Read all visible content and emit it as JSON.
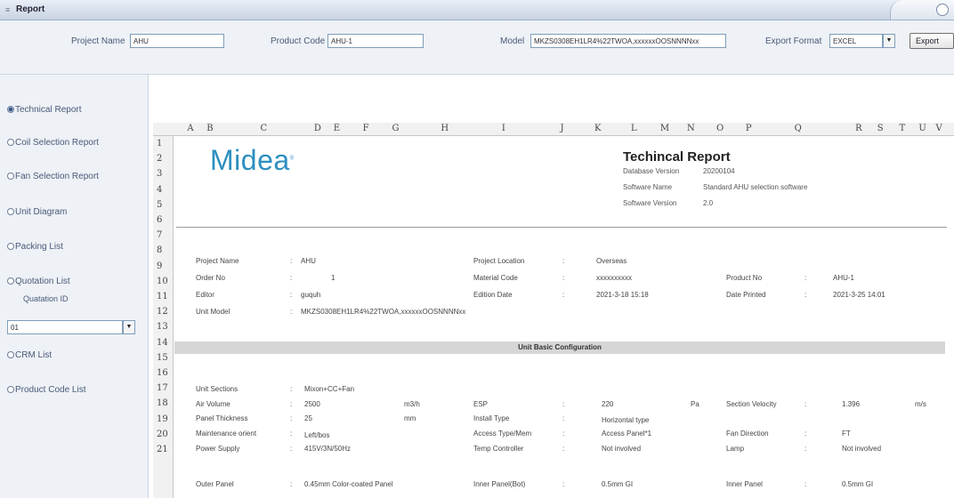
{
  "window": {
    "title": "Report"
  },
  "toolbar": {
    "project_name_label": "Project Name",
    "project_name_value": "AHU",
    "product_code_label": "Product Code",
    "product_code_value": "AHU-1",
    "model_label": "Model",
    "model_value": "MKZS0308EH1LR4%22TWOA,xxxxxxOOSNNNNxx",
    "export_format_label": "Export Format",
    "export_format_value": "EXCEL",
    "export_button": "Export"
  },
  "sidebar": {
    "items": [
      {
        "label": "Technical Report",
        "selected": true
      },
      {
        "label": "Coil Selection Report",
        "selected": false
      },
      {
        "label": "Fan Selection Report",
        "selected": false
      },
      {
        "label": "Unit Diagram",
        "selected": false
      },
      {
        "label": "Packing List",
        "selected": false
      },
      {
        "label": "Quotation List",
        "selected": false
      },
      {
        "label": "CRM List",
        "selected": false
      },
      {
        "label": "Product Code List",
        "selected": false
      }
    ],
    "quotation_id_label": "Quatation ID",
    "quotation_id_value": "01"
  },
  "sheet": {
    "columns": [
      "A",
      "B",
      "C",
      "D",
      "E",
      "F",
      "G",
      "H",
      "I",
      "J",
      "K",
      "L",
      "M",
      "N",
      "O",
      "P",
      "Q",
      "R",
      "S",
      "T",
      "U",
      "V"
    ],
    "rows": [
      "1",
      "2",
      "3",
      "4",
      "5",
      "6",
      "7",
      "8",
      "9",
      "10",
      "11",
      "12",
      "13",
      "14",
      "15",
      "16",
      "17",
      "18",
      "19",
      "20",
      "21"
    ],
    "logo_text": "Midea",
    "report_title": "Techincal Report",
    "meta": [
      {
        "label": "Database Version",
        "value": "20200104"
      },
      {
        "label": "Software Name",
        "value": "Standard AHU selection software"
      },
      {
        "label": "Software Version",
        "value": "2.0"
      }
    ],
    "info": {
      "project_name_label": "Project Name",
      "project_name": "AHU",
      "project_location_label": "Project Location",
      "project_location": "Overseas",
      "order_no_label": "Order No",
      "order_no": "1",
      "material_code_label": "Material Code",
      "material_code": "xxxxxxxxxx",
      "product_no_label": "Product No",
      "product_no": "AHU-1",
      "editor_label": "Editor",
      "editor": "guquh",
      "edition_date_label": "Edition Date",
      "edition_date": "2021-3-18 15:18",
      "date_printed_label": "Date Printed",
      "date_printed": "2021-3-25 14:01",
      "unit_model_label": "Unit Model",
      "unit_model": "MKZS0308EH1LR4%22TWOA,xxxxxxOOSNNNNxx"
    },
    "section_title": "Unit Basic Configuration",
    "config": {
      "unit_sections_label": "Unit Sections",
      "unit_sections": "Mixon+CC+Fan",
      "air_volume_label": "Air Volume",
      "air_volume": "2500",
      "air_volume_unit": "m3/h",
      "esp_label": "ESP",
      "esp": "220",
      "esp_unit": "Pa",
      "section_velocity_label": "Section Velocity",
      "section_velocity": "1.396",
      "section_velocity_unit": "m/s",
      "panel_thickness_label": "Panel Thickness",
      "panel_thickness": "25",
      "panel_thickness_unit": "mm",
      "install_type_label": "Install Type",
      "install_type": "Horizontal type",
      "maintenance_label": "Maintenance orient",
      "maintenance": "Left/bos",
      "access_type_label": "Access Type/Mem",
      "access_type": "Access Panel*1",
      "fan_direction_label": "Fan Direction",
      "fan_direction": "FT",
      "power_supply_label": "Power Supply",
      "power_supply": "415V/3N/50Hz",
      "temp_controller_label": "Temp Controller",
      "temp_controller": "Not involved",
      "lamp_label": "Lamp",
      "lamp": "Not involved",
      "outer_panel_label": "Outer Panel",
      "outer_panel": "0.45mm Color-coated Panel",
      "inner_panel_label": "Inner Panel(Bot)",
      "inner_panel": "0.5mm GI",
      "inner_panel2_label": "Inner Panel",
      "inner_panel2": "0.5mm GI"
    }
  }
}
